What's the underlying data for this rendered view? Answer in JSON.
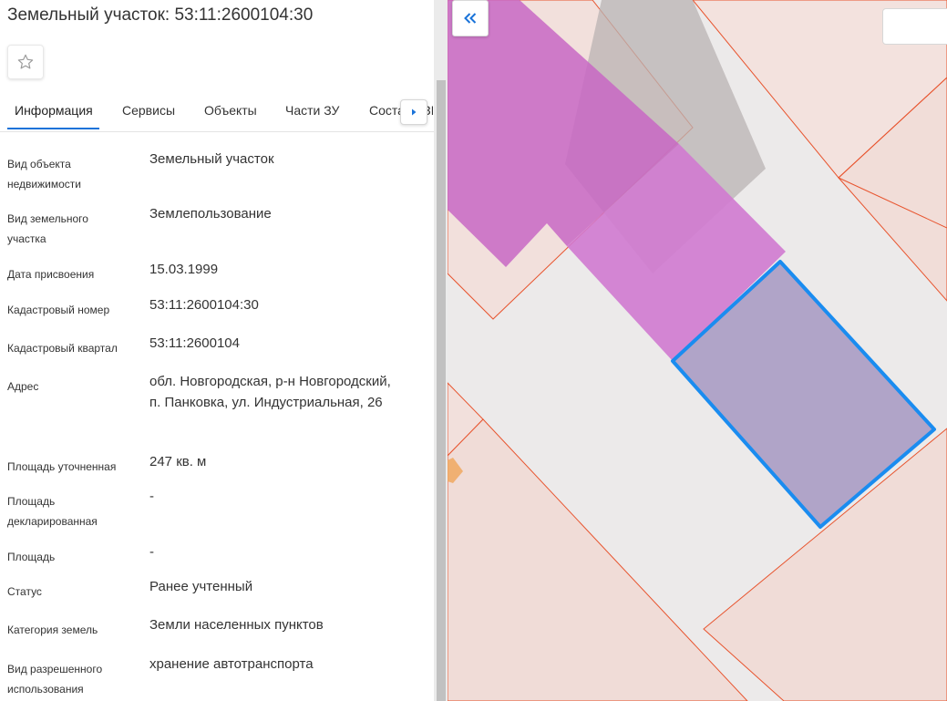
{
  "header": {
    "title": "Земельный участок: 53:11:2600104:30"
  },
  "favorite": {
    "icon": "star-outline-icon"
  },
  "tabs": [
    {
      "label": "Информация",
      "active": true
    },
    {
      "label": "Сервисы"
    },
    {
      "label": "Объекты"
    },
    {
      "label": "Части ЗУ"
    },
    {
      "label": "Состав ЕЗП",
      "partially_hidden": true
    }
  ],
  "tab_next_icon": "caret-right-icon",
  "info": [
    {
      "label": "Вид объекта недвижимости",
      "value": "Земельный участок"
    },
    {
      "label": "Вид земельного участка",
      "value": "Землепользование"
    },
    {
      "label": "Дата присвоения",
      "value": "15.03.1999"
    },
    {
      "label": "Кадастровый номер",
      "value": "53:11:2600104:30"
    },
    {
      "label": "Кадастровый квартал",
      "value": "53:11:2600104"
    },
    {
      "label": "Адрес",
      "value": "обл. Новгородская, р-н Новгородский, п. Панковка, ул. Индустриальная, 26"
    },
    {
      "label": "Площадь уточненная",
      "value": "247 кв. м"
    },
    {
      "label": "Площадь декларированная",
      "value": "-"
    },
    {
      "label": "Площадь",
      "value": "-"
    },
    {
      "label": "Статус",
      "value": "Ранее учтенный"
    },
    {
      "label": "Категория земель",
      "value": "Земли населенных пунктов"
    },
    {
      "label": "Вид разрешенного использования",
      "value": "хранение автотранспорта"
    }
  ],
  "map": {
    "collapse_icon": "double-chevron-left-icon",
    "colors": {
      "background": "#eceaea",
      "parcel_fill": "#f3e2de",
      "parcel_border": "#e8542e",
      "building_fill": "#c867c4",
      "selected_fill": "#b0a4c8",
      "selected_border": "#1a8cf0",
      "shadow": "#b9b3b3"
    }
  }
}
